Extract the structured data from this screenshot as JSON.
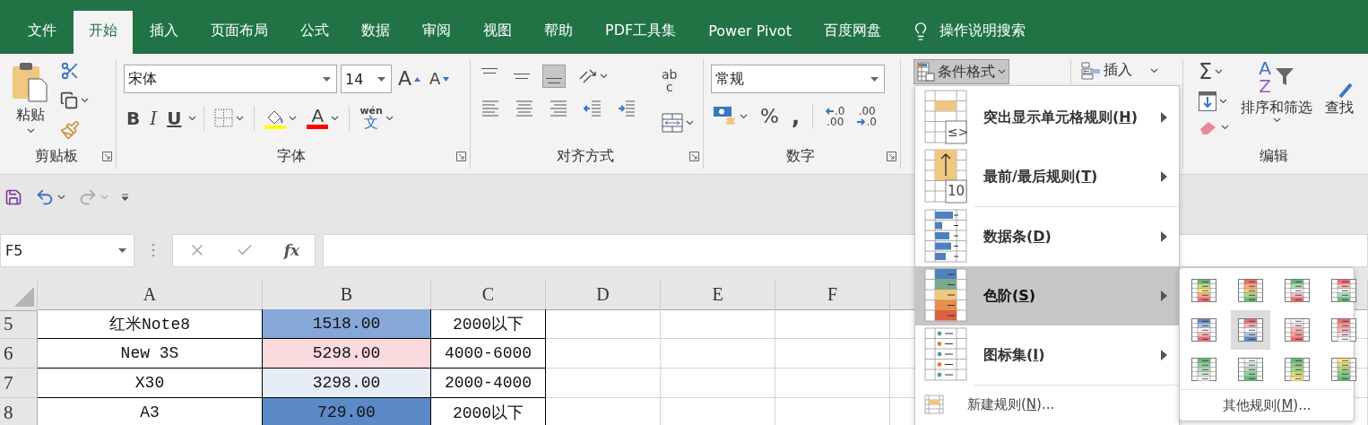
{
  "tabs": [
    {
      "label": "文件",
      "selected": false
    },
    {
      "label": "开始",
      "selected": true
    },
    {
      "label": "插入",
      "selected": false
    },
    {
      "label": "页面布局",
      "selected": false
    },
    {
      "label": "公式",
      "selected": false
    },
    {
      "label": "数据",
      "selected": false
    },
    {
      "label": "审阅",
      "selected": false
    },
    {
      "label": "视图",
      "selected": false
    },
    {
      "label": "帮助",
      "selected": false
    },
    {
      "label": "PDF工具集",
      "selected": false
    },
    {
      "label": "Power Pivot",
      "selected": false
    },
    {
      "label": "百度网盘",
      "selected": false
    }
  ],
  "tell_me": "操作说明搜索",
  "clipboard": {
    "paste": "粘贴",
    "group_label": "剪贴板"
  },
  "font": {
    "name": "宋体",
    "size": "14",
    "grow": "A",
    "shrink": "A",
    "bold": "B",
    "italic": "I",
    "underline": "U",
    "color_letter": "A",
    "phonetic": "wén",
    "phonetic_char": "文",
    "group_label": "字体"
  },
  "alignment": {
    "wrap_top": "ab",
    "wrap_bottom": "c",
    "group_label": "对齐方式"
  },
  "number": {
    "format": "常规",
    "percent": "%",
    "comma": ",",
    "inc_top": ".0",
    "inc_bottom": ".00",
    "dec_top": ".00",
    "dec_bottom": ".0",
    "group_label": "数字"
  },
  "styles": {
    "conditional_formatting": "条件格式",
    "open": true
  },
  "cells": {
    "insert": "插入"
  },
  "editing": {
    "sigma": "Σ",
    "sort_a": "A",
    "sort_z": "Z",
    "sort": "排序和筛选",
    "find": "查找",
    "group_label": "编辑"
  },
  "name_box": "F5",
  "fx": "fx",
  "sheet": {
    "columns": [
      "A",
      "B",
      "C",
      "D",
      "E",
      "F"
    ],
    "rows": [
      {
        "header": "5",
        "cells": [
          {
            "text": "红米Note8"
          },
          {
            "text": "1518.00",
            "color": "#86a8d9"
          },
          {
            "text": "2000以下"
          }
        ]
      },
      {
        "header": "6",
        "cells": [
          {
            "text": "New 3S"
          },
          {
            "text": "5298.00",
            "color": "#fadadd"
          },
          {
            "text": "4000-6000"
          }
        ]
      },
      {
        "header": "7",
        "cells": [
          {
            "text": "X30"
          },
          {
            "text": "3298.00",
            "color": "#e5ecf6"
          },
          {
            "text": "2000-4000"
          }
        ]
      },
      {
        "header": "8",
        "cells": [
          {
            "text": "A3"
          },
          {
            "text": "729.00",
            "color": "#5b8ac6"
          },
          {
            "text": "2000以下"
          }
        ]
      }
    ]
  },
  "conditional_menu": {
    "items": [
      {
        "kind": "highlight",
        "before": "突出显示单元格规则(",
        "key": "H",
        "after": ")",
        "icon_text": "≤>",
        "selected": false
      },
      {
        "kind": "top_bottom",
        "before": "最前/最后规则(",
        "key": "T",
        "after": ")",
        "icon_text": "10",
        "selected": false
      },
      {
        "kind": "data_bars",
        "before": "数据条(",
        "key": "D",
        "after": ")",
        "selected": false
      },
      {
        "kind": "color_scales",
        "before": "色阶(",
        "key": "S",
        "after": ")",
        "selected": true
      },
      {
        "kind": "icon_sets",
        "before": "图标集(",
        "key": "I",
        "after": ")",
        "selected": false
      }
    ],
    "new_rule": {
      "before": "新建规则(",
      "key": "N",
      "after": ")..."
    }
  },
  "color_scales": {
    "swatches": [
      {
        "kind": "gyr",
        "selected": false
      },
      {
        "kind": "ryg",
        "selected": false
      },
      {
        "kind": "gwr",
        "selected": false
      },
      {
        "kind": "rwg",
        "selected": false
      },
      {
        "kind": "bwr",
        "selected": false
      },
      {
        "kind": "rwb",
        "selected": true
      },
      {
        "kind": "wr",
        "selected": false
      },
      {
        "kind": "rw",
        "selected": false
      },
      {
        "kind": "gw",
        "selected": false
      },
      {
        "kind": "wg",
        "selected": false
      },
      {
        "kind": "gy",
        "selected": false
      },
      {
        "kind": "yg",
        "selected": false
      }
    ],
    "more": {
      "before": "其他规则(",
      "key": "M",
      "after": ")..."
    }
  }
}
